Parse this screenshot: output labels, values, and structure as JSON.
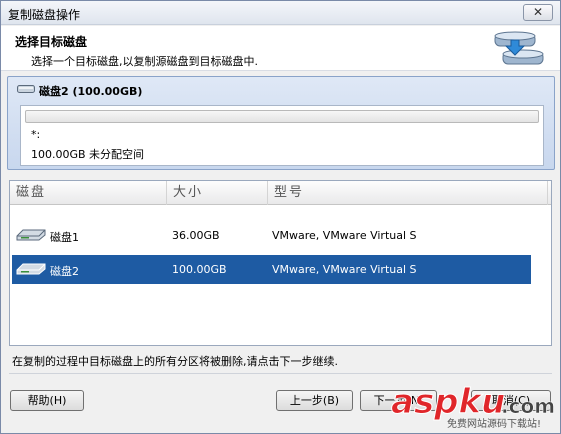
{
  "window": {
    "title": "复制磁盘操作",
    "close_label": "✕"
  },
  "header": {
    "title": "选择目标磁盘",
    "subtitle": "选择一个目标磁盘,以复制源磁盘到目标磁盘中."
  },
  "target": {
    "disk_label": "磁盘2 (100.00GB)",
    "partition_label": "*:",
    "unallocated": "100.00GB 未分配空间"
  },
  "list": {
    "columns": [
      "磁盘",
      "大小",
      "型号"
    ],
    "rows": [
      {
        "name": "磁盘1",
        "size": "36.00GB",
        "model": "VMware, VMware Virtual S",
        "selected": false
      },
      {
        "name": "磁盘2",
        "size": "100.00GB",
        "model": "VMware, VMware Virtual S",
        "selected": true
      }
    ]
  },
  "footer": {
    "note": "在复制的过程中目标磁盘上的所有分区将被删除,请点击下一步继续.",
    "help": "帮助(H)",
    "back": "上一步(B)",
    "next": "下一步(N)",
    "cancel": "取消(C)"
  },
  "watermark": {
    "brand": "aspku",
    "domain": ".com",
    "tagline": "免费网站源码下载站!"
  },
  "colors": {
    "selection": "#1e5ba3",
    "panel": "#c8d7ee",
    "watermark_red": "#e0262a"
  }
}
